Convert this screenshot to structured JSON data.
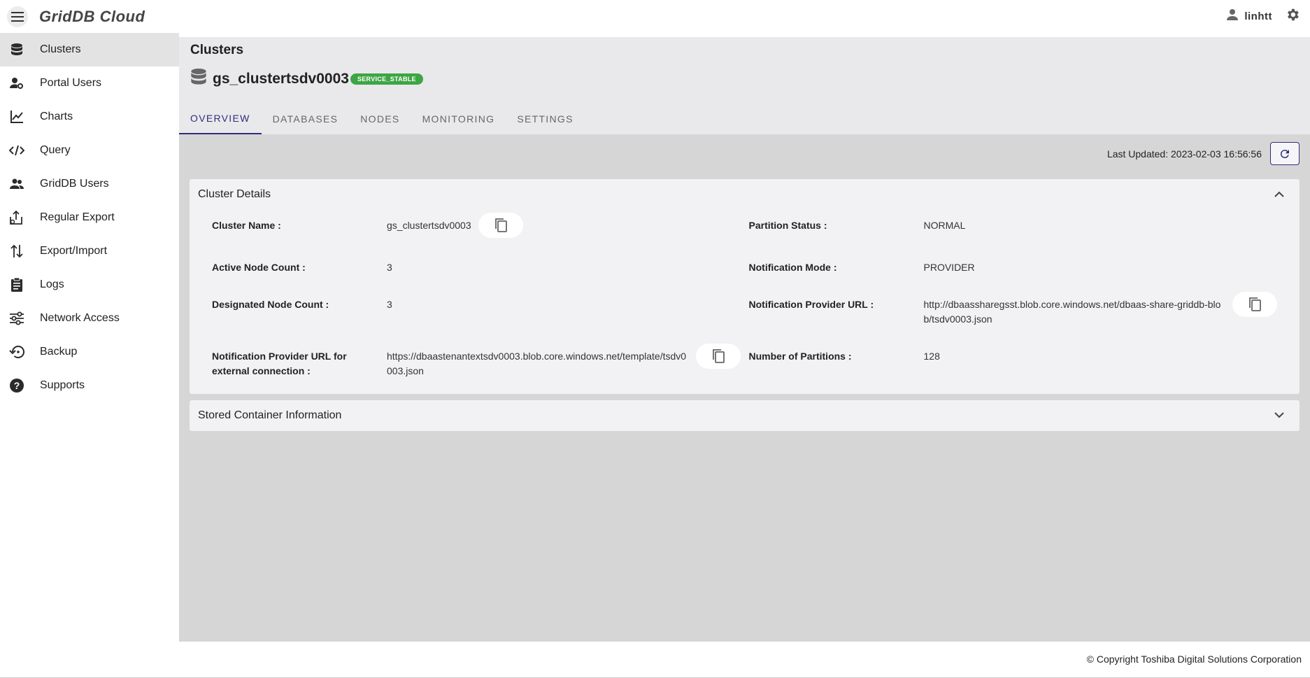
{
  "app": {
    "brand": "GridDB Cloud"
  },
  "sidebar": {
    "items": [
      {
        "label": "Clusters",
        "icon": "database-icon",
        "active": true
      },
      {
        "label": "Portal Users",
        "icon": "user-gear-icon"
      },
      {
        "label": "Charts",
        "icon": "line-chart-icon"
      },
      {
        "label": "Query",
        "icon": "code-icon"
      },
      {
        "label": "GridDB Users",
        "icon": "users-icon"
      },
      {
        "label": "Regular Export",
        "icon": "export-icon"
      },
      {
        "label": "Export/Import",
        "icon": "swap-icon"
      },
      {
        "label": "Logs",
        "icon": "clipboard-icon"
      },
      {
        "label": "Network Access",
        "icon": "network-icon"
      },
      {
        "label": "Backup",
        "icon": "backup-icon"
      },
      {
        "label": "Supports",
        "icon": "help-icon"
      }
    ]
  },
  "topbar": {
    "username": "linhtt"
  },
  "header": {
    "page_title": "Clusters",
    "cluster_name": "gs_clustertsdv0003",
    "status_badge": "SERVICE_STABLE"
  },
  "tabs": [
    {
      "label": "OVERVIEW",
      "active": true
    },
    {
      "label": "DATABASES"
    },
    {
      "label": "NODES"
    },
    {
      "label": "MONITORING"
    },
    {
      "label": "SETTINGS"
    }
  ],
  "last_updated": "Last Updated: 2023-02-03 16:56:56",
  "details": {
    "title": "Cluster Details",
    "left": [
      {
        "label": "Cluster Name :",
        "value": "gs_clustertsdv0003",
        "copy": true
      },
      {
        "label": "Active Node Count :",
        "value": "3"
      },
      {
        "label": "Designated Node Count :",
        "value": "3"
      },
      {
        "label": "Notification Provider URL for external connection :",
        "value": "https://dbaastenantextsdv0003.blob.core.windows.net/template/tsdv0003.json",
        "copy": true
      }
    ],
    "right": [
      {
        "label": "Partition Status :",
        "value": "NORMAL"
      },
      {
        "label": "Notification Mode :",
        "value": "PROVIDER"
      },
      {
        "label": "Notification Provider URL :",
        "value": "http://dbaassharegsst.blob.core.windows.net/dbaas-share-griddb-blob/tsdv0003.json",
        "copy": true
      },
      {
        "label": "Number of Partitions :",
        "value": "128"
      }
    ]
  },
  "stored": {
    "title": "Stored Container Information"
  },
  "footer": {
    "text": "© Copyright Toshiba Digital Solutions Corporation"
  },
  "colors": {
    "accent": "#2e2e7a",
    "badge": "#3da544",
    "main_bg": "#d6d6d6",
    "header_bg": "#e9e9ec"
  }
}
